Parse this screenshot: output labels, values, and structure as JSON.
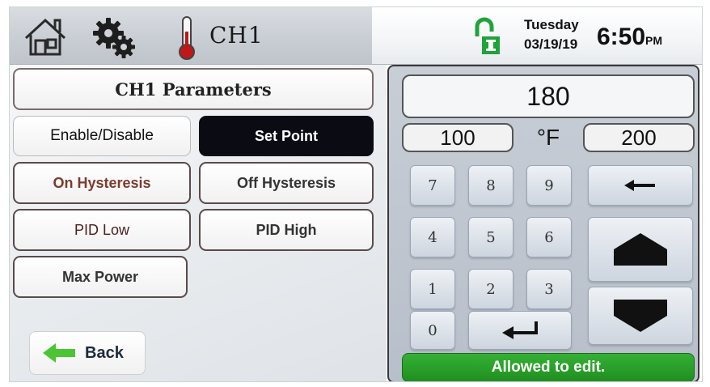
{
  "header": {
    "icons": [
      "home-icon",
      "gear-icon",
      "thermometer-icon",
      "unlocked-lock-icon"
    ],
    "channel": "CH1",
    "day": "Tuesday",
    "date": "03/19/19",
    "time": "6:50",
    "ampm": "PM"
  },
  "params": {
    "title": "CH1 Parameters",
    "enable_label": "Enable/Disable",
    "setpoint_label": "Set Point",
    "on_hys_label": "On Hysteresis",
    "off_hys_label": "Off Hysteresis",
    "pid_low_label": "PID Low",
    "pid_high_label": "PID High",
    "max_power_label": "Max Power",
    "back_label": "Back"
  },
  "keypad": {
    "value": "180",
    "min": "100",
    "max": "200",
    "unit": "°F",
    "keys": [
      "7",
      "8",
      "9",
      "4",
      "5",
      "6",
      "1",
      "2",
      "3",
      "0"
    ],
    "status": "Allowed to edit."
  },
  "colors": {
    "status_green": "#2aa02a",
    "selected_button": "#0b0b14",
    "back_arrow": "#4cc534",
    "lock_green": "#1fa33a",
    "thermometer_red": "#c01818"
  }
}
